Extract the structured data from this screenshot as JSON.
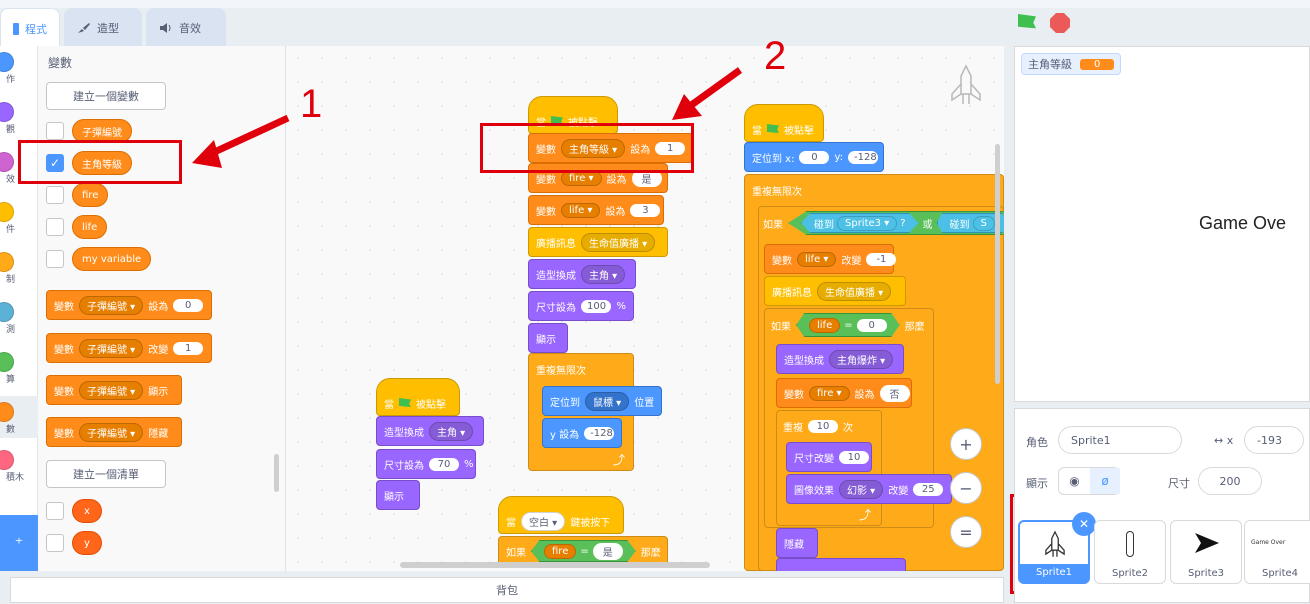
{
  "tabs": {
    "code": "程式",
    "costumes": "造型",
    "sounds": "音效"
  },
  "categories": [
    {
      "label": "作",
      "color": "#4c97ff"
    },
    {
      "label": "觀",
      "color": "#9966ff"
    },
    {
      "label": "效",
      "color": "#cf63cf"
    },
    {
      "label": "件",
      "color": "#ffbf00"
    },
    {
      "label": "制",
      "color": "#ffab19"
    },
    {
      "label": "測",
      "color": "#5cb1d6"
    },
    {
      "label": "算",
      "color": "#59c059"
    },
    {
      "label": "數",
      "color": "#ff8c1a"
    },
    {
      "label": "積木",
      "color": "#ff6680"
    }
  ],
  "palette": {
    "title": "變數",
    "make_variable": "建立一個變數",
    "variables": [
      "子彈編號",
      "主角等級",
      "fire",
      "life",
      "my variable"
    ],
    "checked": "✓",
    "set_block": {
      "kw": "變數",
      "var": "子彈編號 ▾",
      "set": "設為",
      "val": "0"
    },
    "change_block": {
      "kw": "變數",
      "var": "子彈編號 ▾",
      "change": "改變",
      "val": "1"
    },
    "show_block": {
      "kw": "變數",
      "var": "子彈編號 ▾",
      "show": "顯示"
    },
    "hide_block": {
      "kw": "變數",
      "var": "子彈編號 ▾",
      "hide": "隱藏"
    },
    "make_list": "建立一個清單",
    "lists": [
      "x",
      "y"
    ]
  },
  "script1": {
    "hat": {
      "when": "當",
      "clicked": "被點擊"
    },
    "b1": {
      "kw": "變數",
      "var": "主角等級 ▾",
      "set": "設為",
      "val": "1"
    },
    "b2": {
      "kw": "變數",
      "var": "fire ▾",
      "set": "設為",
      "val": "是"
    },
    "b3": {
      "kw": "變數",
      "var": "life ▾",
      "set": "設為",
      "val": "3"
    },
    "b4": {
      "kw": "廣播訊息",
      "msg": "生命值廣播 ▾"
    },
    "b5": {
      "kw": "造型換成",
      "costume": "主角 ▾"
    },
    "b6": {
      "kw": "尺寸設為",
      "val": "100",
      "unit": "%"
    },
    "b7": "顯示",
    "b8": "重複無限次",
    "b9": {
      "kw": "定位到",
      "target": "鼠標 ▾",
      "pos": "位置"
    },
    "b10": {
      "kw": "y 設為",
      "val": "-128"
    },
    "loop_arrow": "⤴"
  },
  "script2": {
    "hat": {
      "when": "當",
      "clicked": "被點擊"
    },
    "b1": {
      "kw": "定位到 x:",
      "x": "0",
      "ykw": "y:",
      "y": "-128"
    },
    "b2": "重複無限次",
    "if1": {
      "kw": "如果",
      "touch": "碰到",
      "s3": "Sprite3 ▾",
      "q": "?",
      "or": "或",
      "touch2": "碰到",
      "s4": "S"
    },
    "b3": {
      "kw": "變數",
      "var": "life ▾",
      "change": "改變",
      "val": "-1"
    },
    "b4": {
      "kw": "廣播訊息",
      "msg": "生命值廣播 ▾"
    },
    "if2": {
      "kw": "如果",
      "var": "life",
      "eq": "=",
      "val": "0",
      "then": "那麼"
    },
    "b5": {
      "kw": "造型換成",
      "costume": "主角爆炸 ▾"
    },
    "b6": {
      "kw": "變數",
      "var": "fire ▾",
      "set": "設為",
      "val": "否"
    },
    "rep": {
      "kw": "重複",
      "val": "10",
      "times": "次"
    },
    "b7": {
      "kw": "尺寸改變",
      "val": "10"
    },
    "b8": {
      "kw": "圖像效果",
      "effect": "幻影 ▾",
      "change": "改變",
      "val": "25"
    },
    "loop_arrow": "⤴",
    "b9": "隱藏"
  },
  "script3": {
    "hat": {
      "when": "當",
      "clicked": "被點擊"
    },
    "b1": {
      "kw": "造型換成",
      "costume": "主角 ▾"
    },
    "b2": {
      "kw": "尺寸設為",
      "val": "70",
      "unit": "%"
    },
    "b3": "顯示"
  },
  "script4": {
    "hat": {
      "when": "當",
      "key": "空白 ▾",
      "pressed": "鍵被按下"
    },
    "if1": {
      "kw": "如果",
      "var": "fire",
      "eq": "=",
      "val": "是",
      "then": "那麼"
    }
  },
  "zoom": {
    "in": "+",
    "out": "−",
    "reset": "="
  },
  "annotations": {
    "n1": "1",
    "n2": "2"
  },
  "stage": {
    "monitor_label": "主角等級",
    "monitor_value": "0",
    "game_over": "Game Ove"
  },
  "sprite_info": {
    "sprite_label": "角色",
    "sprite_name": "Sprite1",
    "x_label": "↔ x",
    "x_value": "-193",
    "show_label": "顯示",
    "size_label": "尺寸",
    "size_value": "200"
  },
  "sprites": [
    "Sprite1",
    "Sprite2",
    "Sprite3",
    "Sprite4"
  ],
  "thumb4_text": "Game Over",
  "backpack": "背包",
  "colors": {
    "accent": "#4c97ff",
    "annotation": "#e0000c",
    "variables": "#ff8c1a"
  }
}
